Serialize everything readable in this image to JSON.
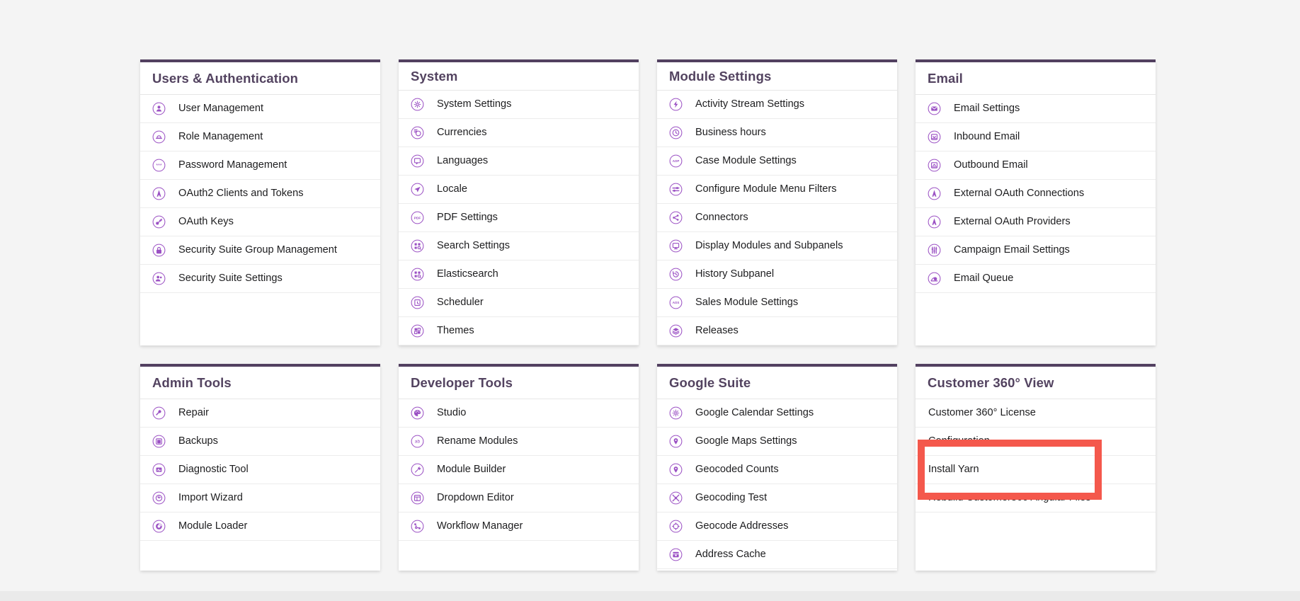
{
  "page": {
    "background_color": "#f4f4f4",
    "accent_color": "#9b51c4",
    "header_color": "#534360",
    "highlight_color": "#f4584c"
  },
  "cards": [
    {
      "title": "Users & Authentication",
      "size": "tall",
      "items": [
        {
          "label": "User Management",
          "icon": "user-icon"
        },
        {
          "label": "Role Management",
          "icon": "role-icon"
        },
        {
          "label": "Password Management",
          "icon": "password-asterisks-icon"
        },
        {
          "label": "OAuth2 Clients and Tokens",
          "icon": "oauth-a-icon"
        },
        {
          "label": "OAuth Keys",
          "icon": "key-icon"
        },
        {
          "label": "Security Suite Group Management",
          "icon": "lock-icon"
        },
        {
          "label": "Security Suite Settings",
          "icon": "users-group-icon"
        }
      ]
    },
    {
      "title": "System",
      "size": "tall",
      "items": [
        {
          "label": "System Settings",
          "icon": "gear-icon"
        },
        {
          "label": "Currencies",
          "icon": "currency-coins-icon"
        },
        {
          "label": "Languages",
          "icon": "speech-bubble-icon"
        },
        {
          "label": "Locale",
          "icon": "paper-plane-icon"
        },
        {
          "label": "PDF Settings",
          "icon": "pdf-icon"
        },
        {
          "label": "Search Settings",
          "icon": "search-grid-icon"
        },
        {
          "label": "Elasticsearch",
          "icon": "search-grid-icon"
        },
        {
          "label": "Scheduler",
          "icon": "clock-square-icon"
        },
        {
          "label": "Themes",
          "icon": "theme-blocks-icon"
        }
      ]
    },
    {
      "title": "Module Settings",
      "size": "tall",
      "items": [
        {
          "label": "Activity Stream Settings",
          "icon": "bolt-icon"
        },
        {
          "label": "Business hours",
          "icon": "clock-check-icon"
        },
        {
          "label": "Case Module Settings",
          "icon": "aop-icon"
        },
        {
          "label": "Configure Module Menu Filters",
          "icon": "sliders-icon"
        },
        {
          "label": "Connectors",
          "icon": "connector-node-icon"
        },
        {
          "label": "Display Modules and Subpanels",
          "icon": "monitor-icon"
        },
        {
          "label": "History Subpanel",
          "icon": "history-clock-icon"
        },
        {
          "label": "Sales Module Settings",
          "icon": "aos-icon"
        },
        {
          "label": "Releases",
          "icon": "layers-icon"
        }
      ]
    },
    {
      "title": "Email",
      "size": "tall",
      "items": [
        {
          "label": "Email Settings",
          "icon": "envelope-icon"
        },
        {
          "label": "Inbound Email",
          "icon": "inbox-down-icon"
        },
        {
          "label": "Outbound Email",
          "icon": "outbox-up-icon"
        },
        {
          "label": "External OAuth Connections",
          "icon": "oauth-a-icon"
        },
        {
          "label": "External OAuth Providers",
          "icon": "oauth-a-icon"
        },
        {
          "label": "Campaign Email Settings",
          "icon": "sliders-vertical-icon"
        },
        {
          "label": "Email Queue",
          "icon": "email-queue-icon"
        }
      ]
    },
    {
      "title": "Admin Tools",
      "size": "short",
      "items": [
        {
          "label": "Repair",
          "icon": "wrench-icon"
        },
        {
          "label": "Backups",
          "icon": "archive-box-icon"
        },
        {
          "label": "Diagnostic Tool",
          "icon": "pulse-chart-icon"
        },
        {
          "label": "Import Wizard",
          "icon": "import-arrow-icon"
        },
        {
          "label": "Module Loader",
          "icon": "loader-ring-icon"
        }
      ]
    },
    {
      "title": "Developer Tools",
      "size": "short",
      "items": [
        {
          "label": "Studio",
          "icon": "palette-icon"
        },
        {
          "label": "Rename Modules",
          "icon": "ab-text-icon"
        },
        {
          "label": "Module Builder",
          "icon": "hammer-icon"
        },
        {
          "label": "Dropdown Editor",
          "icon": "table-layout-icon"
        },
        {
          "label": "Workflow Manager",
          "icon": "workflow-nodes-icon"
        }
      ]
    },
    {
      "title": "Google Suite",
      "size": "short",
      "items": [
        {
          "label": "Google Calendar Settings",
          "icon": "gear-icon"
        },
        {
          "label": "Google Maps Settings",
          "icon": "map-pin-icon"
        },
        {
          "label": "Geocoded Counts",
          "icon": "map-pin-icon"
        },
        {
          "label": "Geocoding Test",
          "icon": "crosshair-burst-icon"
        },
        {
          "label": "Geocode Addresses",
          "icon": "target-circle-icon"
        },
        {
          "label": "Address Cache",
          "icon": "archive-cache-icon"
        }
      ]
    },
    {
      "title": "Customer 360° View",
      "size": "short",
      "items": [
        {
          "label": "Customer 360° License",
          "icon": null
        },
        {
          "label": "Configuration",
          "icon": null
        },
        {
          "label": "Install Yarn",
          "icon": null
        },
        {
          "label": "Rebuild Customer360 Angular Files",
          "icon": null
        }
      ]
    }
  ]
}
